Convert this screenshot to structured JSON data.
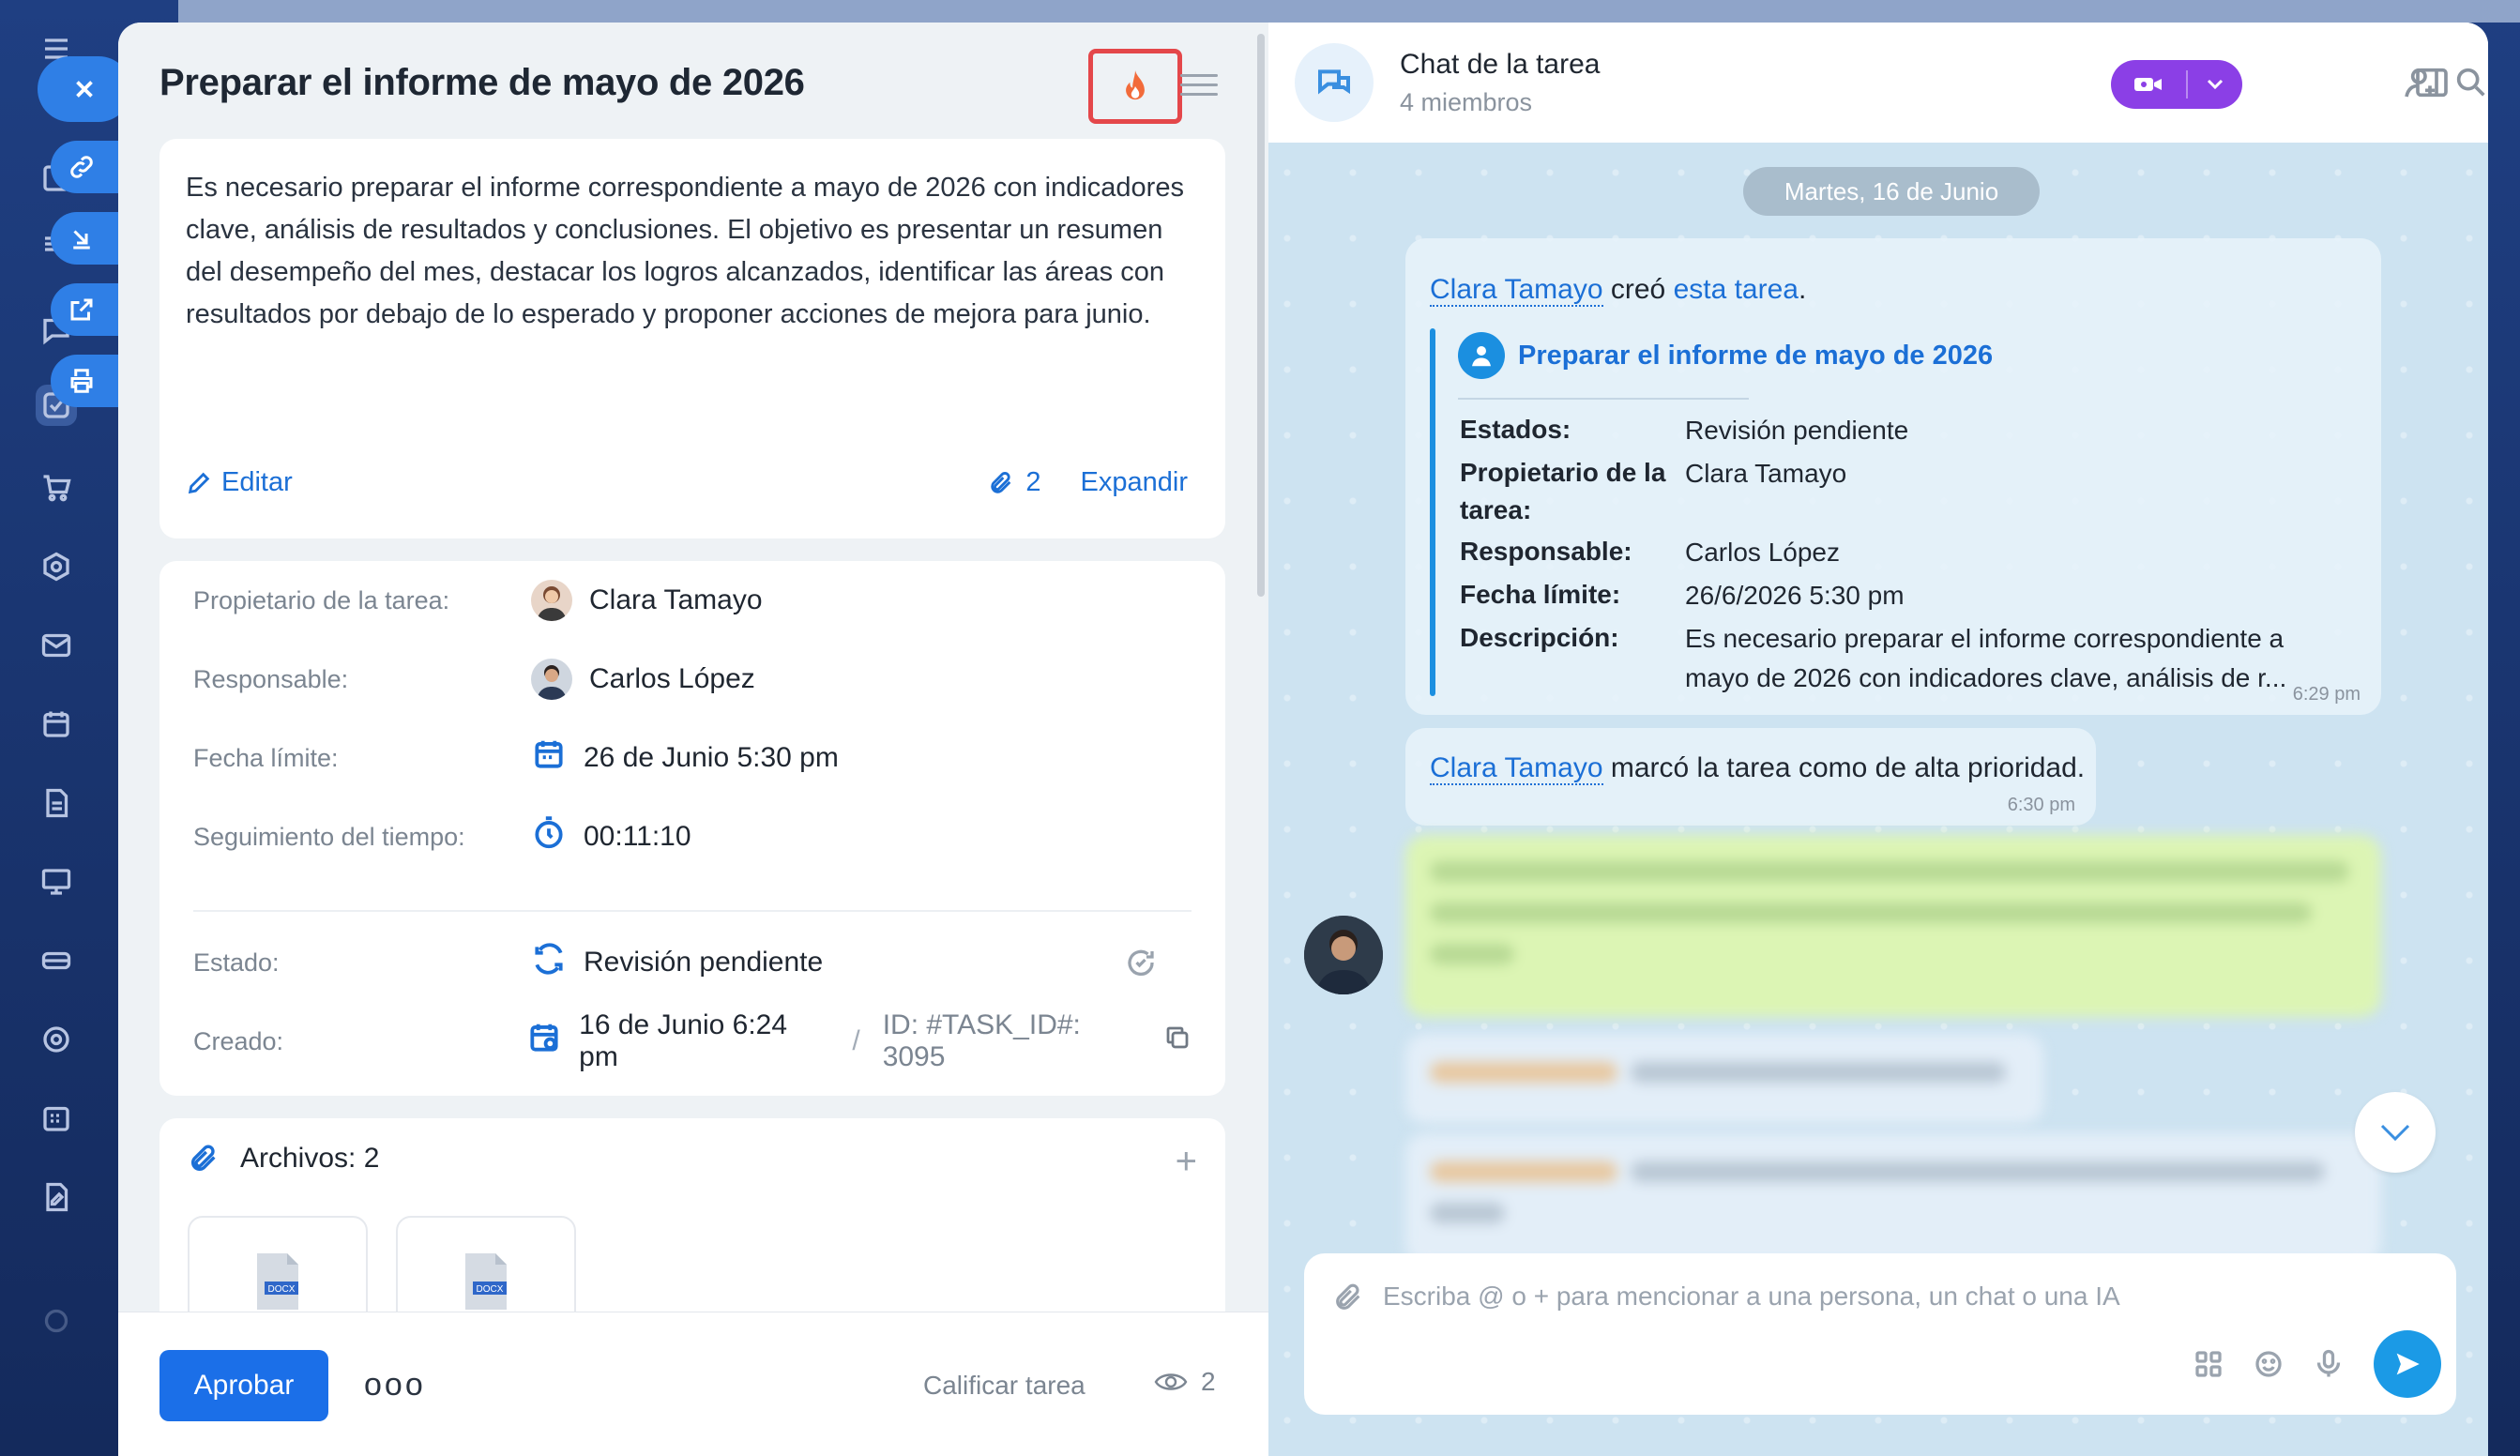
{
  "task": {
    "title": "Preparar el informe de mayo de 2026",
    "description": "Es necesario preparar el informe correspondiente a mayo de 2026 con indicadores clave, análisis de resultados y conclusiones. El objetivo es presentar un resumen del desempeño del mes, destacar los logros alcanzados, identificar las áreas con resultados por debajo de lo esperado y proponer acciones de mejora para junio.",
    "edit_label": "Editar",
    "attachments_count": "2",
    "expand_label": "Expandir",
    "fields": {
      "owner_label": "Propietario de la tarea:",
      "owner_value": "Clara Tamayo",
      "responsible_label": "Responsable:",
      "responsible_value": "Carlos López",
      "deadline_label": "Fecha límite:",
      "deadline_value": "26 de Junio 5:30 pm",
      "time_label": "Seguimiento del tiempo:",
      "time_value": "00:11:10",
      "status_label": "Estado:",
      "status_value": "Revisión pendiente",
      "created_label": "Creado:",
      "created_value": "16 de Junio 6:24 pm",
      "id_separator": "/",
      "id_value": "ID: #TASK_ID#: 3095"
    },
    "files_label": "Archivos: 2",
    "files_plus": "+",
    "file_badges": [
      "DOCX",
      "DOCX"
    ],
    "footer": {
      "approve_label": "Aprobar",
      "more_label": "ooo",
      "rate_label": "Calificar tarea",
      "views_count": "2"
    },
    "priority_color": "#e4474a"
  },
  "chat": {
    "title": "Chat de la tarea",
    "subtitle": "4 miembros",
    "date_pill": "Martes, 16 de Junio",
    "msg1": {
      "author": "Clara Tamayo",
      "verb": " creó ",
      "link": "esta tarea",
      "end": ".",
      "quote_title": "Preparar el informe de mayo de 2026",
      "rows": [
        {
          "k": "Estados:",
          "v": "Revisión pendiente"
        },
        {
          "k": "Propietario de la tarea:",
          "v": "Clara Tamayo"
        },
        {
          "k": "Responsable:",
          "v": "Carlos López"
        },
        {
          "k": "Fecha límite:",
          "v": "26/6/2026 5:30 pm"
        },
        {
          "k": "Descripción:",
          "v": "Es necesario preparar el informe correspondiente a mayo de 2026 con indicadores clave, análisis de r..."
        }
      ],
      "time": "6:29 pm"
    },
    "msg2": {
      "author": "Clara Tamayo",
      "text": " marcó la tarea como de alta prioridad.",
      "time": "6:30 pm"
    },
    "composer_placeholder": "Escriba @ o + para mencionar a una persona, un chat o una IA",
    "video_color": "#8b3fe6"
  }
}
